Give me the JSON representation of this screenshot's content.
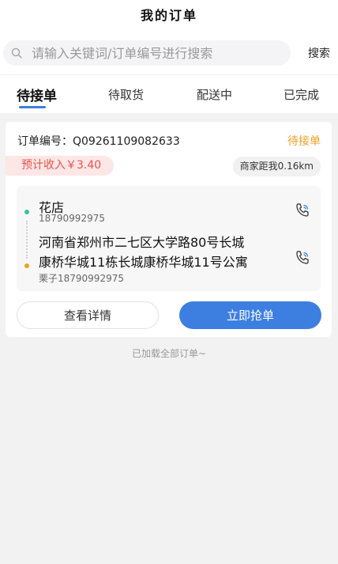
{
  "header": {
    "title": "我的订单"
  },
  "search": {
    "placeholder": "请输入关键词/订单编号进行搜索",
    "value": "",
    "button_label": "搜索"
  },
  "tabs": [
    {
      "label": "待接单",
      "active": true
    },
    {
      "label": "待取货",
      "active": false
    },
    {
      "label": "配送中",
      "active": false
    },
    {
      "label": "已完成",
      "active": false
    }
  ],
  "order": {
    "number_text": "订单编号：Q09261109082633",
    "status": "待接单",
    "income_text": "预计收入￥3.40",
    "distance_text": "商家距我0.16km",
    "pickup": {
      "name": "花店",
      "phone": "18790992975"
    },
    "dropoff": {
      "address_line1": "河南省郑州市二七区大学路80号长城",
      "address_line2": "康桥华城11栋长城康桥华城11号公寓",
      "receiver": "栗子18790992975"
    },
    "detail_button": "查看详情",
    "grab_button": "立即抢单"
  },
  "footer": {
    "loaded_text": "已加载全部订单~"
  },
  "colors": {
    "accent": "#3c7fe0",
    "status_pending": "#f0a020",
    "income_red": "#e8544e",
    "pickup_dot": "#3dbf9a",
    "dropoff_dot": "#f0a020"
  },
  "icons": {
    "search": "search-icon",
    "phone": "phone-call-icon"
  }
}
